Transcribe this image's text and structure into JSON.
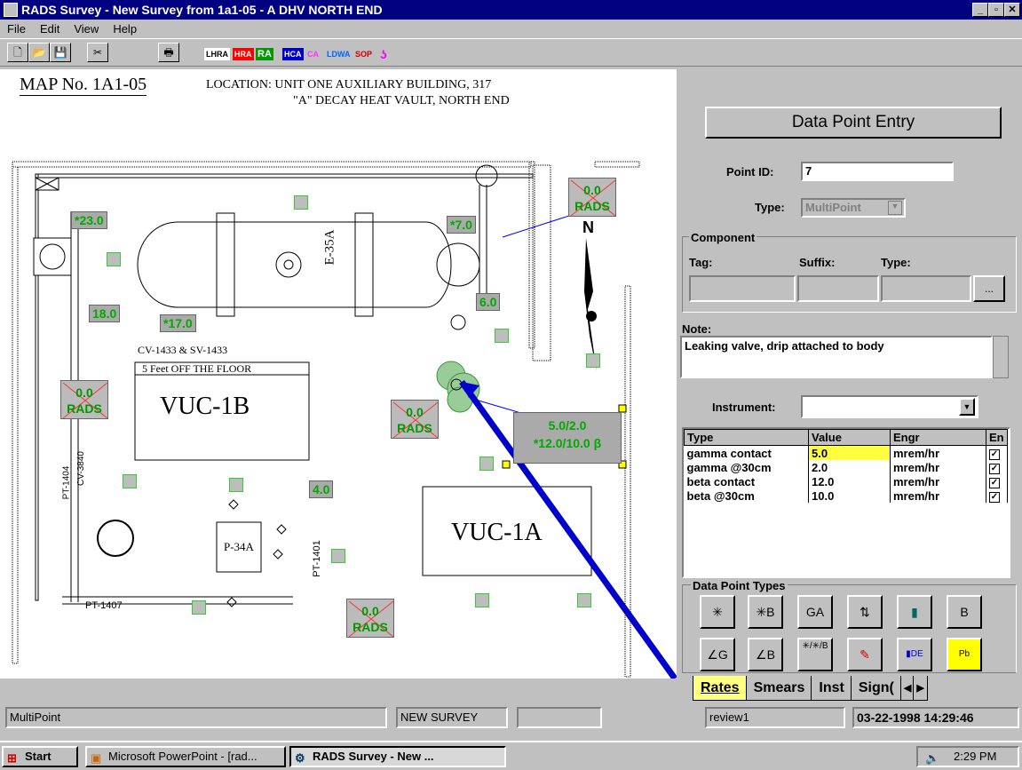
{
  "window": {
    "title": "RADS Survey - New Survey from 1a1-05 - A DHV NORTH END"
  },
  "menu": [
    "File",
    "Edit",
    "View",
    "Help"
  ],
  "toolbar_tags": [
    {
      "label": "LHRA",
      "color": "#cc0000"
    },
    {
      "label": "HRA",
      "color": "#ff0000"
    },
    {
      "label": "RA",
      "color": "#009900"
    },
    {
      "label": "HCA",
      "color": "#0000cc"
    },
    {
      "label": "CA",
      "color": "#ff33ff"
    },
    {
      "label": "LDWA",
      "color": "#0066ff"
    },
    {
      "label": "SOP",
      "color": "#cc0000"
    }
  ],
  "map": {
    "map_no": "MAP No. 1A1-05",
    "location_line1": "LOCATION: UNIT ONE AUXILIARY BUILDING, 317",
    "location_line2": "\"A\" DECAY HEAT VAULT, NORTH END",
    "labels": {
      "e35a": "E-35A",
      "cv": "CV-1433 & SV-1433",
      "feet": "5 Feet OFF THE FLOOR",
      "vuc1b": "VUC-1B",
      "vuc1a": "VUC-1A",
      "p34a": "P-34A",
      "pt1404": "PT-1404",
      "cv3840": "CV-3840",
      "pt1407": "PT-1407",
      "pt1401": "PT-1401",
      "north": "N"
    },
    "values": [
      "*23.0",
      "*7.0",
      "18.0",
      "*17.0",
      "6.0",
      "4.0"
    ],
    "rads": {
      "value": "0.0",
      "label": "RADS"
    },
    "multipoint_line1": "5.0/2.0",
    "multipoint_line2": "*12.0/10.0 β"
  },
  "panel": {
    "title": "Data Point Entry",
    "point_id_label": "Point ID:",
    "point_id": "7",
    "type_label": "Type:",
    "type_value": "MultiPoint",
    "component_label": "Component",
    "tag_label": "Tag:",
    "suffix_label": "Suffix:",
    "ctype_label": "Type:",
    "browse": "...",
    "note_label": "Note:",
    "note": "Leaking valve, drip attached to body",
    "instrument_label": "Instrument:",
    "grid_headers": [
      "Type",
      "Value",
      "Engr",
      "En"
    ],
    "grid_rows": [
      {
        "type": "gamma contact",
        "value": "5.0",
        "engr": "mrem/hr"
      },
      {
        "type": "gamma @30cm",
        "value": "2.0",
        "engr": "mrem/hr"
      },
      {
        "type": "beta contact",
        "value": "12.0",
        "engr": "mrem/hr"
      },
      {
        "type": "beta @30cm",
        "value": "10.0",
        "engr": "mrem/hr"
      }
    ],
    "dpt_label": "Data Point Types",
    "dpt_buttons": [
      "✳",
      "✳B",
      "GA",
      "⇅",
      "▮",
      "B",
      "∠G",
      "∠B",
      "✳/✳/B",
      "✎",
      "▮DE",
      "Pb"
    ],
    "tabs": [
      "Rates",
      "Smears",
      "Inst",
      "Sign("
    ]
  },
  "statusbar": {
    "mode": "MultiPoint",
    "survey": "NEW SURVEY",
    "user": "review1",
    "datetime": "03-22-1998  14:29:46"
  },
  "taskbar": {
    "start": "Start",
    "item1": "Microsoft PowerPoint - [rad...",
    "item2": "RADS Survey - New ...",
    "clock": "2:29 PM"
  }
}
